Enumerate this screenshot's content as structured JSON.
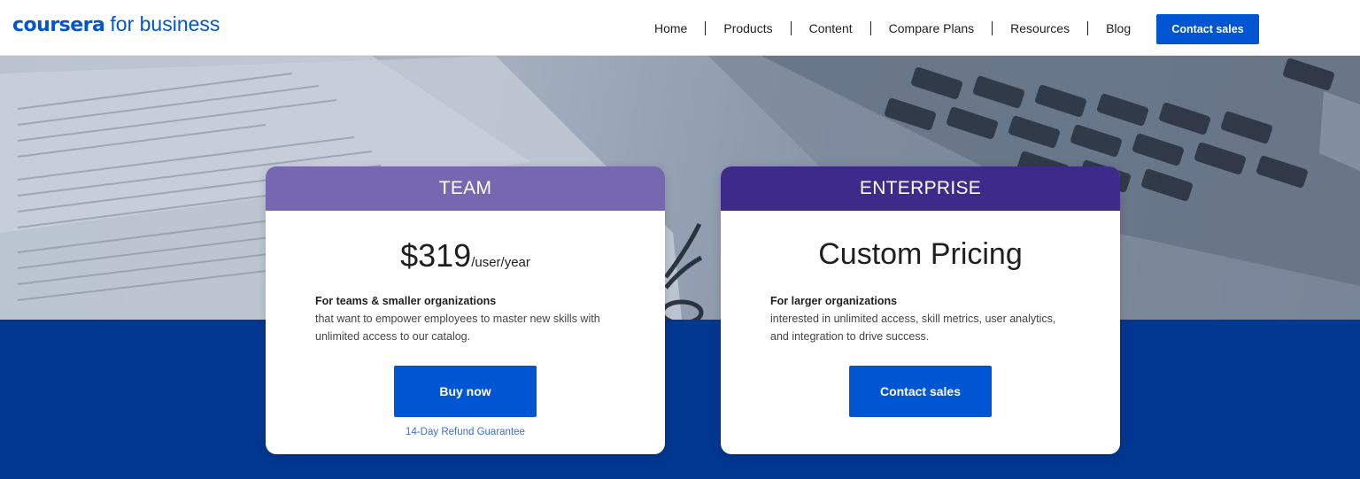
{
  "header": {
    "logo_brand": "coursera",
    "logo_suffix": "for business",
    "nav": [
      {
        "label": "Home"
      },
      {
        "label": "Products"
      },
      {
        "label": "Content"
      },
      {
        "label": "Compare Plans"
      },
      {
        "label": "Resources"
      },
      {
        "label": "Blog"
      }
    ],
    "cta_label": "Contact sales"
  },
  "plans": {
    "team": {
      "name": "TEAM",
      "price": "$319",
      "unit": "/user/year",
      "desc_title": "For teams & smaller organizations",
      "desc_body": "that want to empower employees to master new skills with unlimited access to our catalog.",
      "button_label": "Buy now",
      "guarantee": "14-Day Refund Guarantee"
    },
    "enterprise": {
      "name": "ENTERPRISE",
      "price": "Custom Pricing",
      "desc_title": "For larger organizations",
      "desc_body": "interested in unlimited access, skill metrics, user analytics, and integration to drive success.",
      "button_label": "Contact sales"
    }
  },
  "colors": {
    "brand_blue": "#0056d2",
    "team_header": "#7568b0",
    "enterprise_header": "#3d2b8c",
    "band": "#003790"
  }
}
